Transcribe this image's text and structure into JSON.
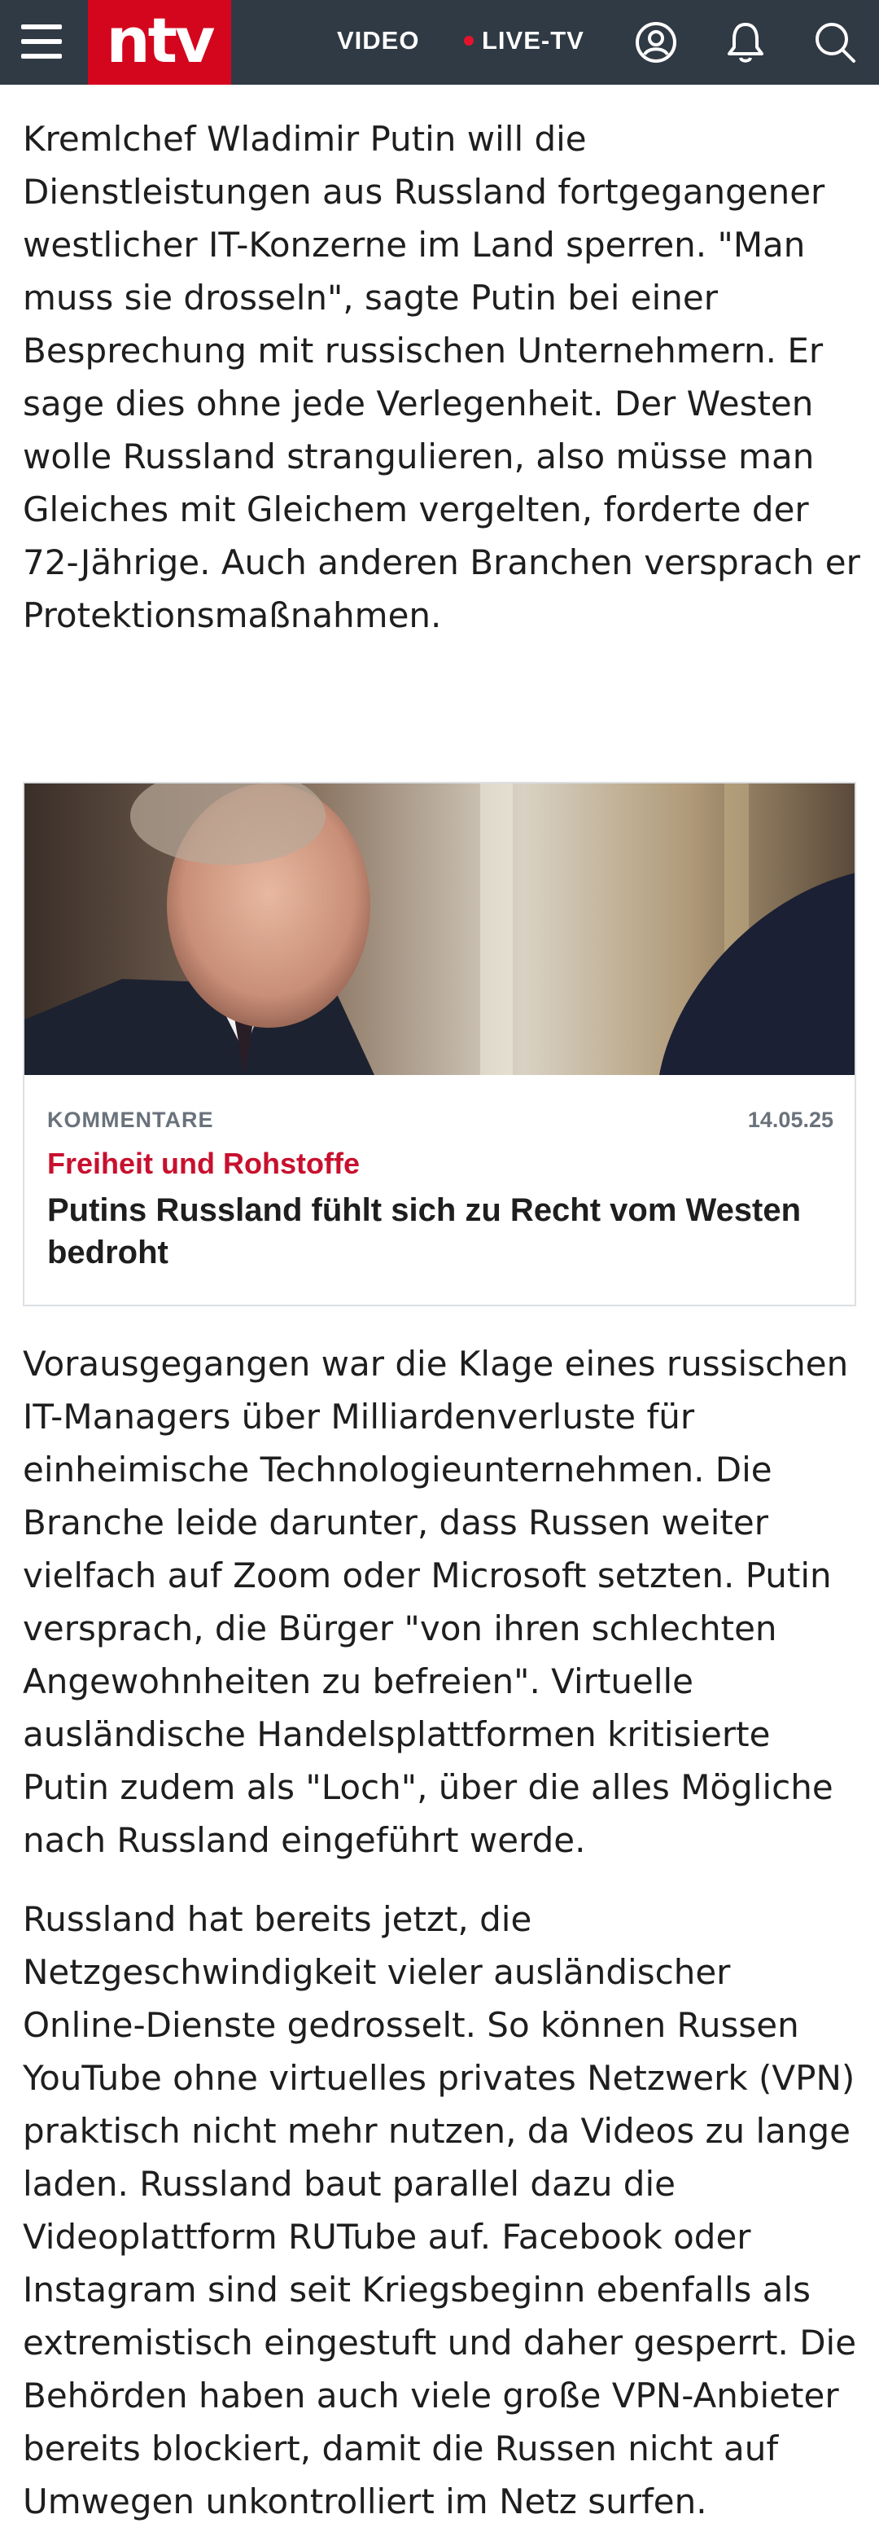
{
  "header": {
    "logo_text": "ntv",
    "nav_video": "VIDEO",
    "nav_live": "LIVE-TV",
    "icons": [
      "menu-icon",
      "user-icon",
      "bell-icon",
      "search-icon"
    ],
    "colors": {
      "bar": "#303a45",
      "brand": "#d3061e",
      "live_dot": "#e4132b"
    }
  },
  "article": {
    "paragraphs": [
      "Kremlchef Wladimir Putin will die Dienstleistungen aus Russland fortgegangener westlicher IT-Konzerne im Land sperren. \"Man muss sie drosseln\", sagte Putin bei einer Besprechung mit russischen Unternehmern. Er sage dies ohne jede Verlegenheit. Der Westen wolle Russland strangulieren, also müsse man Gleiches mit Gleichem vergelten, forderte der 72-Jährige. Auch anderen Branchen versprach er Protektionsmaßnahmen.",
      "Vorausgegangen war die Klage eines russischen IT-Managers über Milliardenverluste für einheimische Technologieunternehmen. Die Branche leide darunter, dass Russen weiter vielfach auf Zoom oder Microsoft setzten. Putin versprach, die Bürger \"von ihren schlechten Angewohnheiten zu befreien\". Virtuelle ausländische Handelsplattformen kritisierte Putin zudem als \"Loch\", über die alles Mögliche nach Russland eingeführt werde.",
      "Russland hat bereits jetzt, die Netzgeschwindigkeit vieler ausländischer Online-Dienste gedrosselt. So können Russen YouTube ohne virtuelles privates Netzwerk (VPN) praktisch nicht mehr nutzen, da Videos zu lange laden. Russland baut parallel dazu die Videoplattform RUTube auf. Facebook oder Instagram sind seit Kriegsbeginn ebenfalls als extremistisch eingestuft und daher gesperrt. Die Behörden haben auch viele große VPN-Anbieter bereits blockiert, damit die Russen nicht auf Umwegen unkontrolliert im Netz surfen."
    ]
  },
  "teaser": {
    "category": "KOMMENTARE",
    "date": "14.05.25",
    "kicker": "Freiheit und Rohstoffe",
    "title": "Putins Russland fühlt sich zu Recht vom Westen bedroht",
    "colors": {
      "kicker": "#c8102e",
      "meta": "#6a727b"
    }
  }
}
